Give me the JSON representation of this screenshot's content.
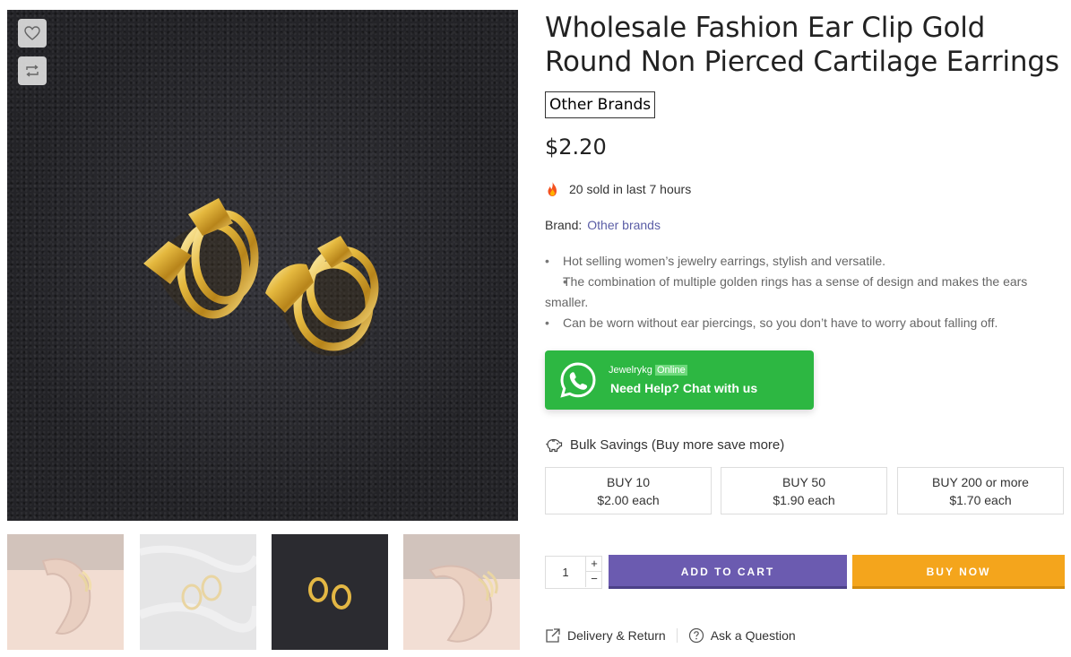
{
  "gallery": {
    "wishlist_icon": "heart-icon",
    "compare_icon": "compare-arrows-icon",
    "thumbnails": [
      "ear-model",
      "earrings-on-fabric",
      "earrings-on-dark",
      "ear-model-closeup"
    ]
  },
  "product": {
    "title": "Wholesale Fashion Ear Clip Gold Round Non Pierced Cartilage Earrings",
    "vendor_tag": "Other Brands",
    "price": "$2.20",
    "sold_text": "20 sold in last 7 hours",
    "brand_label": "Brand:",
    "brand_value": "Other brands",
    "features": [
      "Hot selling women’s jewelry earrings, stylish and versatile.",
      "The combination of multiple golden rings has a sense of design and makes the ears smaller.",
      "Can be worn without ear piercings, so you don’t have to worry about falling off."
    ]
  },
  "whatsapp": {
    "agent": "Jewelrykg",
    "status": "Online",
    "cta": "Need Help? Chat with us"
  },
  "bulk": {
    "heading": "Bulk Savings (Buy more save more)",
    "tiers": [
      {
        "qty": "BUY 10",
        "price": "$2.00 each"
      },
      {
        "qty": "BUY 50",
        "price": "$1.90 each"
      },
      {
        "qty": "BUY 200 or more",
        "price": "$1.70 each"
      }
    ]
  },
  "purchase": {
    "quantity": "1",
    "plus": "+",
    "minus": "−",
    "add_to_cart": "ADD TO CART",
    "buy_now": "BUY NOW"
  },
  "footer_links": {
    "delivery": "Delivery & Return",
    "question": "Ask a Question"
  },
  "colors": {
    "add_to_cart": "#6b5bb0",
    "buy_now": "#f4a51c",
    "whatsapp": "#2db742",
    "brand_link": "#5b5ea6"
  }
}
